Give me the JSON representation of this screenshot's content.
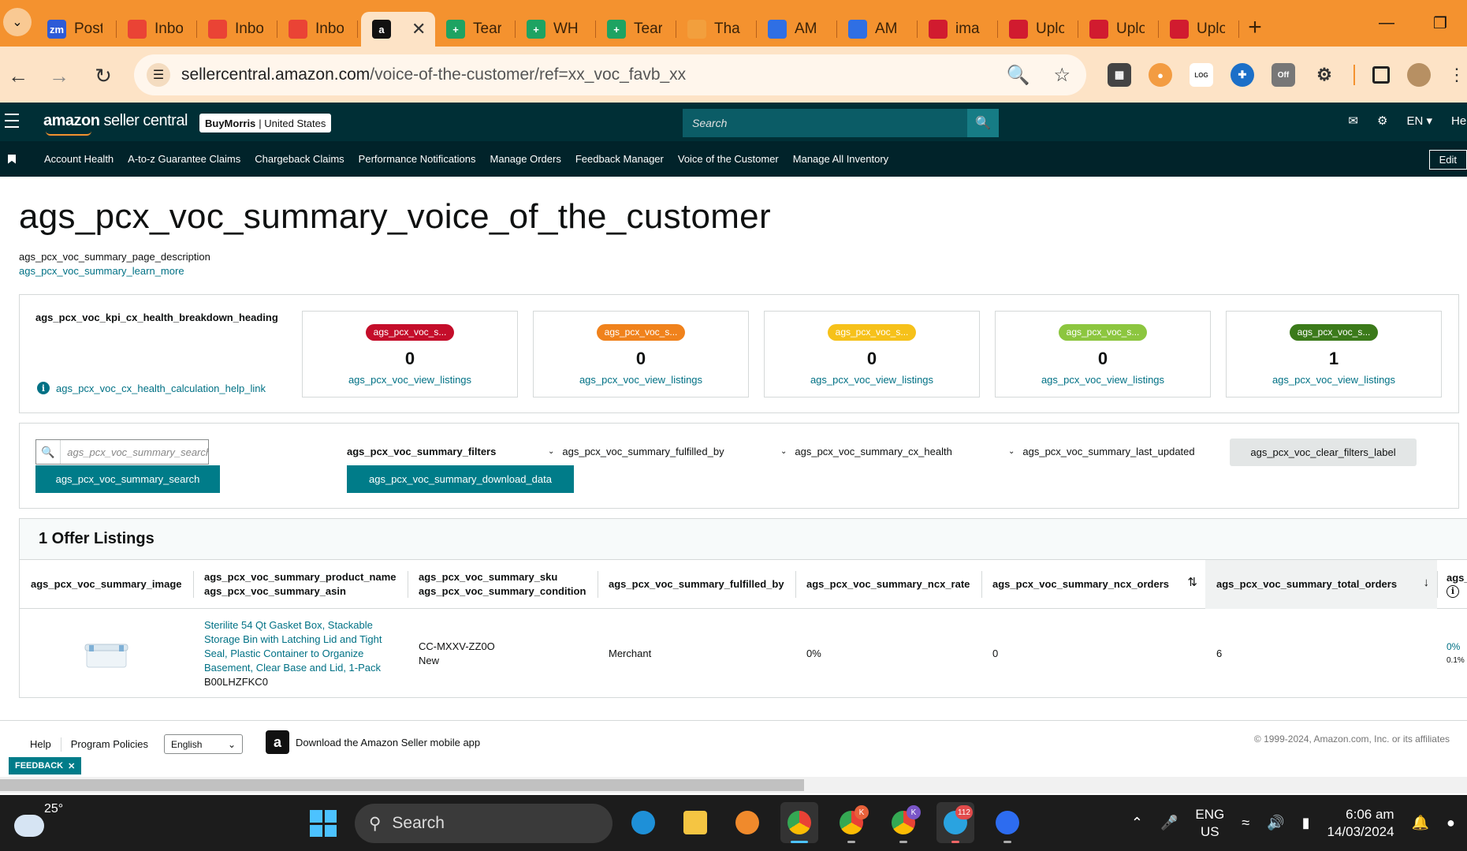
{
  "browser": {
    "tabs": [
      {
        "title": "Post",
        "icon": "zoom-icon",
        "color": "#2d5bd7"
      },
      {
        "title": "Inbo",
        "icon": "gmail-icon",
        "color": "#ea4335"
      },
      {
        "title": "Inbo",
        "icon": "gmail-icon",
        "color": "#ea4335"
      },
      {
        "title": "Inbo",
        "icon": "gmail-icon",
        "color": "#ea4335"
      },
      {
        "title": "",
        "icon": "amazon-icon",
        "color": "#111111",
        "active": true
      },
      {
        "title": "Tear",
        "icon": "sheets-icon",
        "color": "#1ea362"
      },
      {
        "title": "WH",
        "icon": "sheets-icon",
        "color": "#1ea362"
      },
      {
        "title": "Tear",
        "icon": "sheets-icon",
        "color": "#1ea362"
      },
      {
        "title": "Tha",
        "icon": "pen-icon",
        "color": "#f29f3d"
      },
      {
        "title": "AM",
        "icon": "pen-icon",
        "color": "#2f6fe4"
      },
      {
        "title": "AM",
        "icon": "pen-icon",
        "color": "#2f6fe4"
      },
      {
        "title": "ima",
        "icon": "shield-icon",
        "color": "#d11b2f"
      },
      {
        "title": "Uplo",
        "icon": "shield-icon",
        "color": "#d11b2f"
      },
      {
        "title": "Uplo",
        "icon": "shield-icon",
        "color": "#d11b2f"
      },
      {
        "title": "Uplo",
        "icon": "shield-icon",
        "color": "#d11b2f"
      }
    ],
    "url_host": "sellercentral.amazon.com",
    "url_path": "/voice-of-the-customer/ref=xx_voc_favb_xx"
  },
  "sc_header": {
    "logo_bold": "amazon",
    "logo_light": " seller central",
    "store_name": "BuyMorris",
    "store_region": "United States",
    "search_placeholder": "Search",
    "language": "EN",
    "help": "Help"
  },
  "nav_links": [
    "Account Health",
    "A-to-z Guarantee Claims",
    "Chargeback Claims",
    "Performance Notifications",
    "Manage Orders",
    "Feedback Manager",
    "Voice of the Customer",
    "Manage All Inventory"
  ],
  "nav_edit": "Edit",
  "page": {
    "title": "ags_pcx_voc_summary_voice_of_the_customer",
    "description": "ags_pcx_voc_summary_page_description",
    "learn_more": "ags_pcx_voc_summary_learn_more"
  },
  "kpi": {
    "heading": "ags_pcx_voc_kpi_cx_health_breakdown_heading",
    "help_link": "ags_pcx_voc_cx_health_calculation_help_link",
    "cards": [
      {
        "badge": "ags_pcx_voc_s...",
        "color": "#c40d2a",
        "count": "0",
        "link": "ags_pcx_voc_view_listings"
      },
      {
        "badge": "ags_pcx_voc_s...",
        "color": "#f0821c",
        "count": "0",
        "link": "ags_pcx_voc_view_listings"
      },
      {
        "badge": "ags_pcx_voc_s...",
        "color": "#f6c11a",
        "count": "0",
        "link": "ags_pcx_voc_view_listings"
      },
      {
        "badge": "ags_pcx_voc_s...",
        "color": "#8cc63f",
        "count": "0",
        "link": "ags_pcx_voc_view_listings"
      },
      {
        "badge": "ags_pcx_voc_s...",
        "color": "#3b7a1a",
        "count": "1",
        "link": "ags_pcx_voc_view_listings"
      }
    ]
  },
  "filters": {
    "search_placeholder": "ags_pcx_voc_summary_search",
    "search_button": "ags_pcx_voc_summary_search",
    "filters_label": "ags_pcx_voc_summary_filters",
    "download_button": "ags_pcx_voc_summary_download_data",
    "fulfilled_by": "ags_pcx_voc_summary_fulfilled_by",
    "cx_health": "ags_pcx_voc_summary_cx_health",
    "last_updated": "ags_pcx_voc_summary_last_updated",
    "clear_button": "ags_pcx_voc_clear_filters_label"
  },
  "listings": {
    "heading": "1 Offer Listings",
    "columns": {
      "image": "ags_pcx_voc_summary_image",
      "product_name": "ags_pcx_voc_summary_product_name",
      "asin": "ags_pcx_voc_summary_asin",
      "sku": "ags_pcx_voc_summary_sku",
      "condition": "ags_pcx_voc_summary_condition",
      "fulfilled_by": "ags_pcx_voc_summary_fulfilled_by",
      "ncx_rate": "ags_pcx_voc_summary_ncx_rate",
      "ncx_orders": "ags_pcx_voc_summary_ncx_orders",
      "total_orders": "ags_pcx_voc_summary_total_orders",
      "next": "ags_"
    },
    "rows": [
      {
        "product_name": "Sterilite 54 Qt Gasket Box, Stackable Storage Bin with Latching Lid and Tight Seal, Plastic Container to Organize Basement, Clear Base and Lid, 1-Pack",
        "asin": "B00LHZFKC0",
        "sku": "CC-MXXV-ZZ0O",
        "condition": "New",
        "fulfilled_by": "Merchant",
        "ncx_rate": "0%",
        "ncx_orders": "0",
        "total_orders": "6",
        "next_primary": "0%",
        "next_secondary": "0.1%"
      }
    ]
  },
  "footer": {
    "help": "Help",
    "policies": "Program Policies",
    "language": "English",
    "app_download": "Download the Amazon Seller mobile app",
    "copyright": "© 1999-2024, Amazon.com, Inc. or its affiliates",
    "feedback": "FEEDBACK"
  },
  "taskbar": {
    "temperature": "25°",
    "search": "Search",
    "lang_top": "ENG",
    "lang_bottom": "US",
    "time": "6:06 am",
    "date": "14/03/2024",
    "telegram_badge": "112",
    "chrome_profile_1": "K",
    "chrome_profile_2": "K"
  }
}
